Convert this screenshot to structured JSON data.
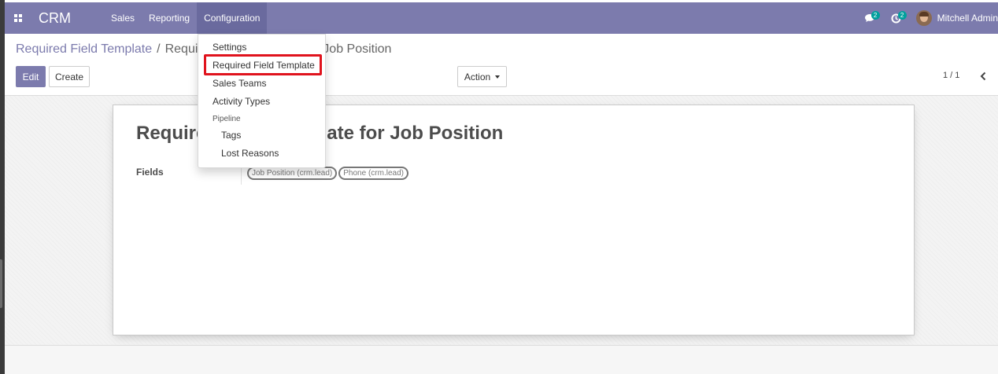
{
  "navbar": {
    "app_name": "CRM",
    "menu": [
      "Sales",
      "Reporting",
      "Configuration"
    ],
    "active_menu": "Configuration",
    "messages_badge": "2",
    "activities_badge": "2",
    "user_name": "Mitchell Admin",
    "bg_color": "#7c7bad"
  },
  "breadcrumb": {
    "parent": "Required Field Template",
    "separator": "/",
    "current": "Required Field Template for Job Position"
  },
  "buttons": {
    "edit": "Edit",
    "create": "Create",
    "action": "Action"
  },
  "pager": {
    "value": "1 / 1"
  },
  "record": {
    "title": "Required Field Template for Job Position",
    "fields_label": "Fields",
    "field_tags": [
      "Job Position (crm.lead)",
      "Phone (crm.lead)"
    ]
  },
  "dropdown": {
    "items": [
      {
        "label": "Settings"
      },
      {
        "label": "Required Field Template",
        "highlighted": true
      },
      {
        "label": "Sales Teams"
      },
      {
        "label": "Activity Types"
      }
    ],
    "section_header": "Pipeline",
    "sub_items": [
      "Tags",
      "Lost Reasons"
    ],
    "highlight_color": "#e0131d"
  },
  "icons": [
    "apps-grid-icon",
    "chat-icon",
    "clock-icon",
    "chevron-left-icon",
    "caret-down-icon"
  ]
}
